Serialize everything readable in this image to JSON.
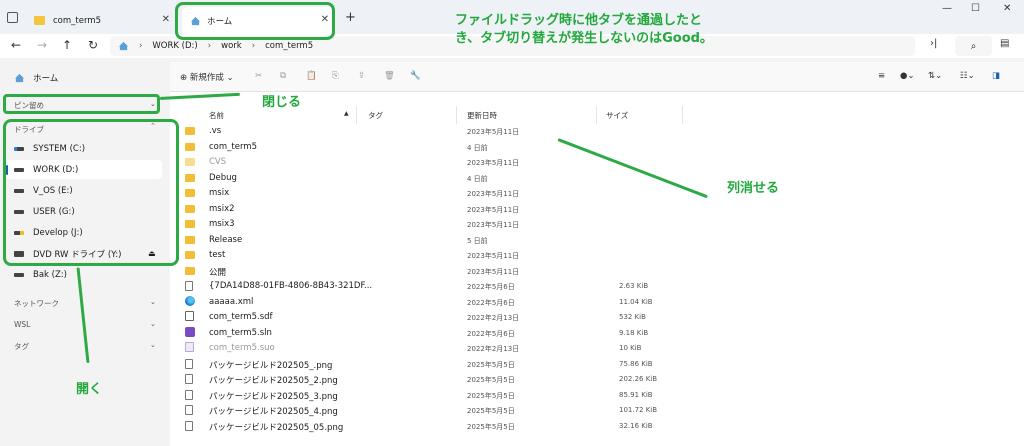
{
  "tabs": [
    {
      "label": "com_term5",
      "active": false
    },
    {
      "label": "ホーム",
      "active": true
    }
  ],
  "window_controls": {
    "minimize": "—",
    "maximize": "☐",
    "close": "✕"
  },
  "nav": {
    "back": "←",
    "forward": "→",
    "up": "↑",
    "refresh": "↻",
    "breadcrumb": [
      "WORK (D:)",
      "work",
      "com_term5"
    ],
    "expand": "›|",
    "search": "⌕"
  },
  "sidebar": {
    "home": "ホーム",
    "pinned": "ピン留め",
    "drives_header": "ドライブ",
    "drives": [
      {
        "label": "SYSTEM (C:)",
        "selected": false
      },
      {
        "label": "WORK (D:)",
        "selected": true
      },
      {
        "label": "V_OS (E:)",
        "selected": false
      },
      {
        "label": "USER (G:)",
        "selected": false
      },
      {
        "label": "Develop (J:)",
        "selected": false
      },
      {
        "label": "DVD RW ドライブ (Y:)",
        "selected": false
      },
      {
        "label": "Bak (Z:)",
        "selected": false
      }
    ],
    "sections": [
      "ネットワーク",
      "WSL",
      "タグ"
    ]
  },
  "toolbar": {
    "new": "新規作成"
  },
  "columns": {
    "name": "名前",
    "tag": "タグ",
    "modified": "更新日時",
    "size": "サイズ"
  },
  "files": [
    {
      "name": ".vs",
      "date": "2023年5月11日",
      "size": "",
      "icon": "folder"
    },
    {
      "name": "com_term5",
      "date": "4 日前",
      "size": "",
      "icon": "folder"
    },
    {
      "name": "CVS",
      "date": "2023年5月11日",
      "size": "",
      "icon": "folder-dim"
    },
    {
      "name": "Debug",
      "date": "4 日前",
      "size": "",
      "icon": "folder"
    },
    {
      "name": "msix",
      "date": "2023年5月11日",
      "size": "",
      "icon": "folder"
    },
    {
      "name": "msix2",
      "date": "2023年5月11日",
      "size": "",
      "icon": "folder"
    },
    {
      "name": "msix3",
      "date": "2023年5月11日",
      "size": "",
      "icon": "folder"
    },
    {
      "name": "Release",
      "date": "5 日前",
      "size": "",
      "icon": "folder"
    },
    {
      "name": "test",
      "date": "2023年5月11日",
      "size": "",
      "icon": "folder"
    },
    {
      "name": "公開",
      "date": "2023年5月11日",
      "size": "",
      "icon": "folder"
    },
    {
      "name": "{7DA14D88-01FB-4806-8B43-321DF...",
      "date": "2022年5月6日",
      "size": "2.63 KiB",
      "icon": "file"
    },
    {
      "name": "aaaaa.xml",
      "date": "2022年5月6日",
      "size": "11.04 KiB",
      "icon": "edge"
    },
    {
      "name": "com_term5.sdf",
      "date": "2022年2月13日",
      "size": "532 KiB",
      "icon": "sdf"
    },
    {
      "name": "com_term5.sln",
      "date": "2022年5月6日",
      "size": "9.18 KiB",
      "icon": "sln"
    },
    {
      "name": "com_term5.suo",
      "date": "2022年2月13日",
      "size": "10 KiB",
      "icon": "suo"
    },
    {
      "name": "パッケージビルド202505_.png",
      "date": "2025年5月5日",
      "size": "75.86 KiB",
      "icon": "file"
    },
    {
      "name": "パッケージビルド202505_2.png",
      "date": "2025年5月5日",
      "size": "202.26 KiB",
      "icon": "file"
    },
    {
      "name": "パッケージビルド202505_3.png",
      "date": "2025年5月5日",
      "size": "85.91 KiB",
      "icon": "file"
    },
    {
      "name": "パッケージビルド202505_4.png",
      "date": "2025年5月5日",
      "size": "101.72 KiB",
      "icon": "file"
    },
    {
      "name": "パッケージビルド202505_05.png",
      "date": "2025年5月5日",
      "size": "32.16 KiB",
      "icon": "file"
    }
  ],
  "annotations": {
    "top_line1": "ファイルドラッグ時に他タブを通過したと",
    "top_line2": "き、タブ切り替えが発生しないのはGood。",
    "close": "閉じる",
    "open": "開く",
    "remove_column": "列消せる"
  }
}
